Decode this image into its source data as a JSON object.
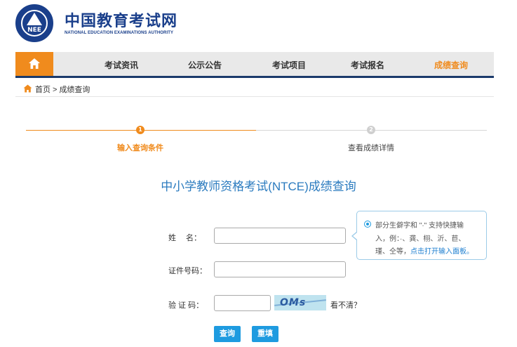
{
  "logo": {
    "emblem_text": "NEE",
    "title_cn": "中国教育考试网",
    "title_en": "NATIONAL EDUCATION EXAMINATIONS AUTHORITY"
  },
  "nav": {
    "items": [
      {
        "label": "考试资讯"
      },
      {
        "label": "公示公告"
      },
      {
        "label": "考试项目"
      },
      {
        "label": "考试报名"
      },
      {
        "label": "成绩查询"
      }
    ],
    "active_color": "#f08b1d"
  },
  "breadcrumb": {
    "home": "首页",
    "separator": ">",
    "current": "成绩查询"
  },
  "steps": [
    {
      "number": "1",
      "label": "输入查询条件"
    },
    {
      "number": "2",
      "label": "查看成绩详情"
    }
  ],
  "page_title": "中小学教师资格考试(NTCE)成绩查询",
  "form": {
    "name_label": "姓　 名：",
    "name_value": "",
    "id_label": "证件号码：",
    "id_value": "",
    "captcha_label": "验 证 码：",
    "captcha_value": "",
    "captcha_image_text": "OMs",
    "cant_see": "看不清？",
    "query_button": "查询",
    "reset_button": "重填"
  },
  "tip": {
    "line1": "部分生僻字和 \"·\" 支持快捷输",
    "line2": "入，例：·、龚、栩、沂、苣、",
    "line3_text": "瑾、仝等，",
    "line3_link": "点击打开输入面板。"
  },
  "colors": {
    "accent_orange": "#f08b1d",
    "nav_bar": "#e9e9e9",
    "nav_border": "#1b3a6b",
    "brand_blue": "#1a3f8b",
    "button_blue": "#1e9be0",
    "title_blue": "#2b7bbf"
  }
}
